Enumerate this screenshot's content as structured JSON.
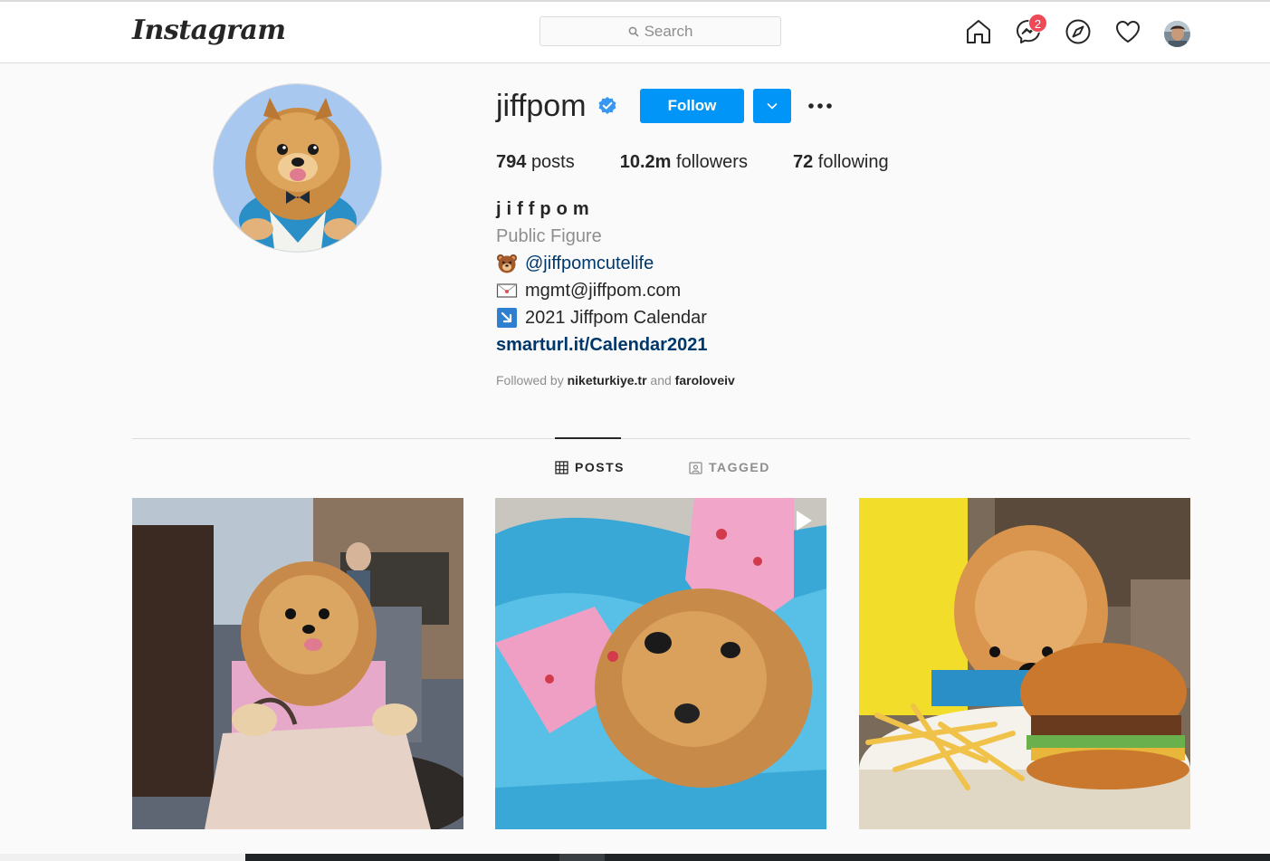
{
  "header": {
    "logo": "Instagram",
    "search_placeholder": "Search",
    "messages_badge": "2"
  },
  "profile": {
    "username": "jiffpom",
    "follow_label": "Follow",
    "stats": {
      "posts_count": "794",
      "posts_label": "posts",
      "followers_count": "10.2m",
      "followers_label": "followers",
      "following_count": "72",
      "following_label": "following"
    },
    "full_name": "jiffpom",
    "category": "Public Figure",
    "bio_mention": "@jiffpomcutelife",
    "bio_email": "mgmt@jiffpom.com",
    "bio_calendar": "2021 Jiffpom Calendar",
    "bio_link": "smarturl.it/Calendar2021",
    "followed_by_prefix": "Followed by",
    "followed_by_1": "niketurkiye.tr",
    "followed_by_and": "and",
    "followed_by_2": "faroloveiv"
  },
  "tabs": {
    "posts": "POSTS",
    "tagged": "TAGGED"
  },
  "colors": {
    "accent": "#0095f6",
    "badge": "#ed4956",
    "link": "#00376b"
  }
}
